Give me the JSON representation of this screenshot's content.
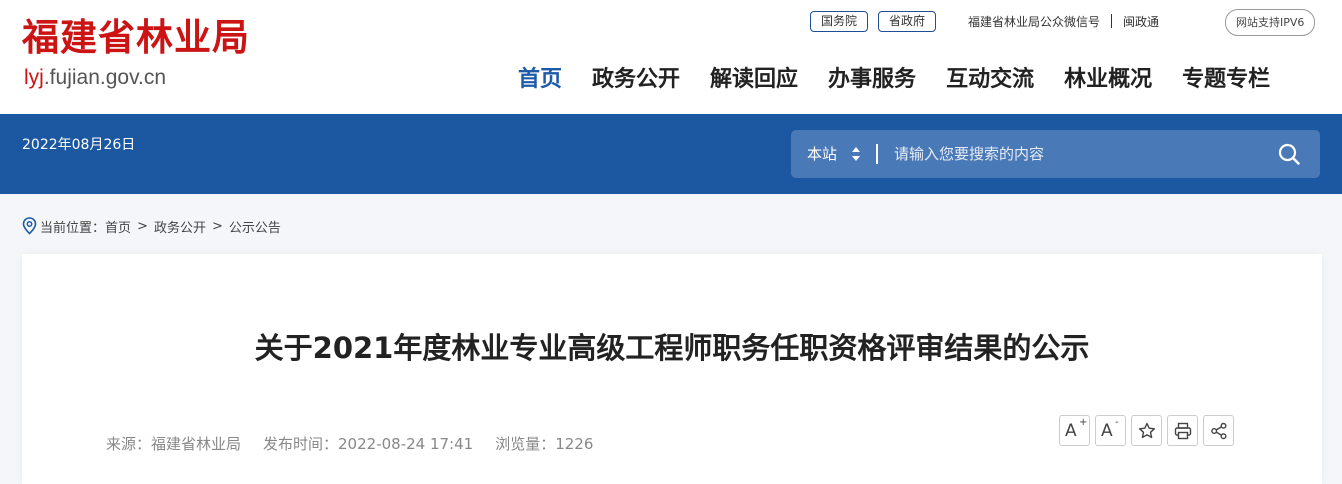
{
  "header": {
    "logo_cn": "福建省林业局",
    "logo_en_highlight": "lyj",
    "logo_en_rest": ".fujian.gov.cn",
    "top_links": {
      "guowuyuan": "国务院",
      "shengzhengfu": "省政府",
      "wechat": "福建省林业局公众微信号",
      "mzt": "闽政通"
    },
    "ipv6": "网站支持IPV6",
    "nav": [
      "首页",
      "政务公开",
      "解读回应",
      "办事服务",
      "互动交流",
      "林业概况",
      "专题专栏"
    ]
  },
  "bar": {
    "date": "2022年08月26日",
    "search": {
      "scope": "本站",
      "placeholder": "请输入您要搜索的内容",
      "value": ""
    }
  },
  "breadcrumb": {
    "label": "当前位置：",
    "items": [
      "首页",
      "政务公开",
      "公示公告"
    ],
    "separator": ">"
  },
  "article": {
    "title": "关于2021年度林业专业高级工程师职务任职资格评审结果的公示",
    "source": "来源：福建省林业局",
    "publish_time": "发布时间：2022-08-24 17:41",
    "views": "浏览量：1226"
  },
  "tools": {
    "font_larger": "A",
    "font_larger_mark": "+",
    "font_smaller": "A",
    "font_smaller_mark": "-"
  },
  "colors": {
    "brand_red": "#cc1414",
    "brand_blue": "#1c58a2",
    "nav_active": "#1d5aa8"
  },
  "icons": [
    "location-icon",
    "updown-arrow-icon",
    "search-icon",
    "star-icon",
    "print-icon",
    "share-icon"
  ]
}
